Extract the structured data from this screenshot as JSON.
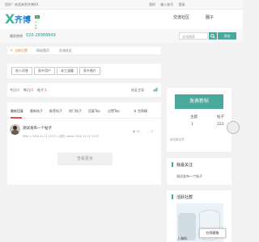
{
  "topbar": {
    "welcome": "您好！欢迎来到齐博XX",
    "links": [
      "我的",
      "输入账号",
      "登录"
    ]
  },
  "logo": {
    "name": "齐博",
    "tag": "X1",
    "sub": "点击图"
  },
  "nav": [
    "交流社区",
    "圈子"
  ],
  "hotline": {
    "label": "服务热线",
    "number": "020-28988849"
  },
  "search": {
    "placeholder": "全站搜索",
    "post_label": "发帖"
  },
  "breadcrumb": [
    "当前位置",
    "网站首页",
    "交流社区"
  ],
  "categories": [
    "吃人问答",
    "家乡用户",
    "本工温暖",
    "家乡图片"
  ],
  "stats": {
    "today_label": "今日:",
    "today_value": "0",
    "yesterday_label": "昨日:",
    "yesterday_value": "0",
    "posts_label": "帖子:",
    "posts_value": "1",
    "rank": "社区主导"
  },
  "tabs": [
    "最新回复",
    "最新帖子",
    "推荐帖子",
    "热门帖子",
    "回复Top",
    "点赞Top"
  ],
  "sort_label": "克帮精",
  "post": {
    "title": "测试发布一个帖子",
    "meta": "Mike  ◷ 2020-12-21 10:32  ◷ 回复: admin 2020-12-21 10:32",
    "views": "◉ 14",
    "replies": "◌ 0"
  },
  "more_label": "查看更多",
  "sidebar": {
    "post_button": "发表新帖",
    "stats": [
      {
        "label": "主题",
        "value": "1"
      },
      {
        "label": "帖子",
        "value": "0"
      },
      {
        "label": "会员",
        "value": "222"
      }
    ],
    "footer": "欢迎新会员:",
    "section_title": "我最关注",
    "follow_item": "测试发布一个帖子",
    "ad_title": "活跃社群",
    "ad_caption": "上海科"
  },
  "online_service": "在线客服",
  "colors": {
    "accent": "#4aa89c",
    "highlight": "#e74c3c",
    "link": "#e67e22"
  }
}
